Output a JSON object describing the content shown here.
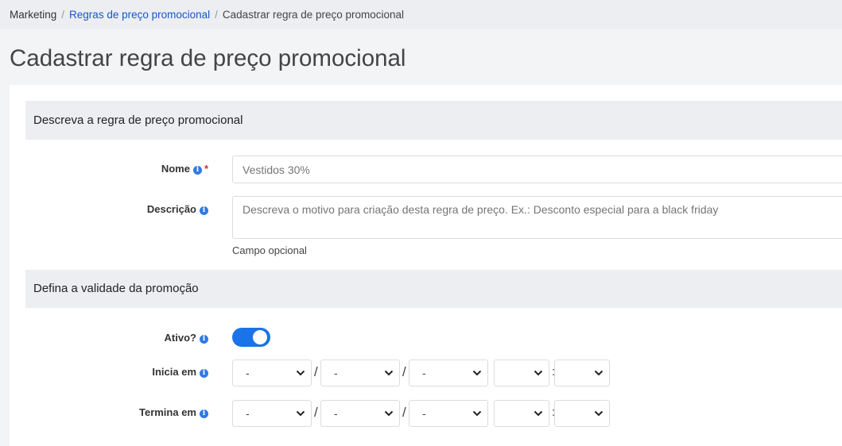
{
  "breadcrumb": {
    "items": [
      "Marketing",
      "Regras de preço promocional",
      "Cadastrar regra de preço promocional"
    ],
    "separator": "/"
  },
  "page_title": "Cadastrar regra de preço promocional",
  "section1": {
    "title": "Descreva a regra de preço promocional",
    "name_label": "Nome",
    "name_required_mark": "*",
    "name_placeholder": "Vestidos 30%",
    "description_label": "Descrição",
    "description_placeholder": "Descreva o motivo para criação desta regra de preço. Ex.: Desconto especial para a black friday",
    "description_help": "Campo opcional"
  },
  "section2": {
    "title": "Defina a validade da promoção",
    "active_label": "Ativo?",
    "active_value": true,
    "start_label": "Inicia em",
    "end_label": "Termina em",
    "start": {
      "day": "-",
      "month": "-",
      "year": "-",
      "hour": "",
      "minute": ""
    },
    "end": {
      "day": "-",
      "month": "-",
      "year": "-",
      "hour": "",
      "minute": ""
    },
    "date_separator": "/",
    "time_separator": ":"
  },
  "icons": {
    "info": "info-icon",
    "chevron": "chevron-down-icon"
  },
  "colors": {
    "accent": "#1a73e8",
    "link": "#1a56c8",
    "required": "#d62d2d",
    "info_icon": "#2f7ae5"
  }
}
